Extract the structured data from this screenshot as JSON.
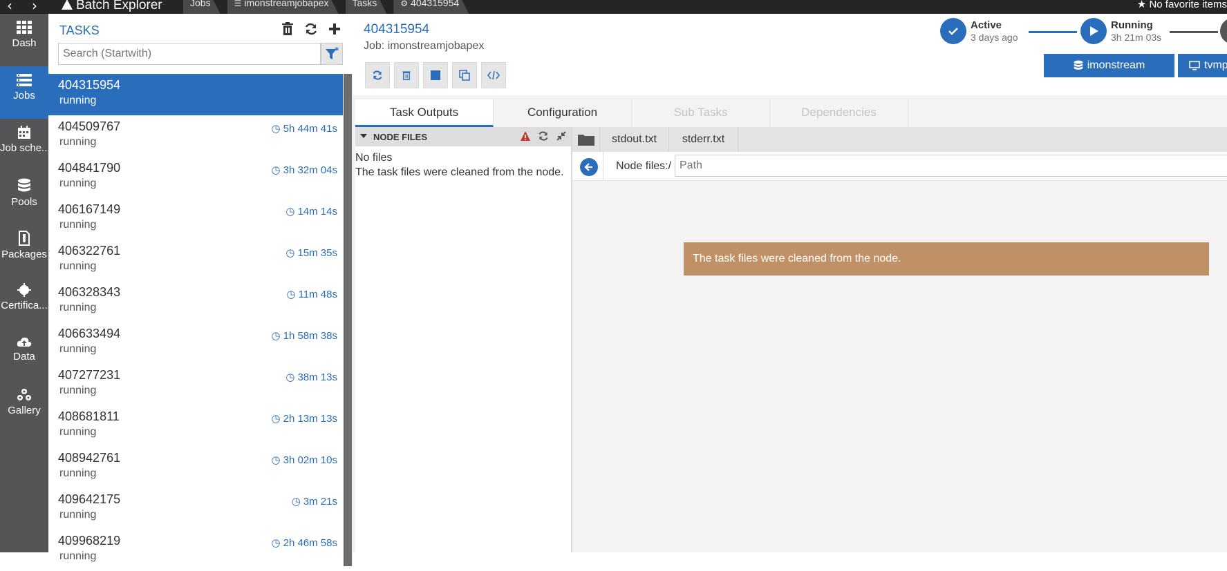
{
  "titlebar": {
    "app_title": "Batch Explorer",
    "breadcrumbs": [
      "Jobs",
      "imonstreamjobapex",
      "Tasks",
      "404315954"
    ],
    "favorites": "No favorite items"
  },
  "leftnav": {
    "items": [
      {
        "label": "Dash",
        "icon": "dashboard-icon"
      },
      {
        "label": "Jobs",
        "icon": "jobs-icon",
        "active": true
      },
      {
        "label": "Job sche...",
        "icon": "calendar-icon"
      },
      {
        "label": "Pools",
        "icon": "database-icon"
      },
      {
        "label": "Packages",
        "icon": "package-icon"
      },
      {
        "label": "Certifica...",
        "icon": "certificate-icon"
      },
      {
        "label": "Data",
        "icon": "cloud-upload-icon"
      },
      {
        "label": "Gallery",
        "icon": "gallery-icon"
      }
    ]
  },
  "tasklist": {
    "title": "TASKS",
    "search_placeholder": "Search (Startwith)",
    "tasks": [
      {
        "id": "404315954",
        "state": "running",
        "time": ""
      },
      {
        "id": "404509767",
        "state": "running",
        "time": "5h 44m 41s"
      },
      {
        "id": "404841790",
        "state": "running",
        "time": "3h 32m 04s"
      },
      {
        "id": "406167149",
        "state": "running",
        "time": "14m 14s"
      },
      {
        "id": "406322761",
        "state": "running",
        "time": "15m 35s"
      },
      {
        "id": "406328343",
        "state": "running",
        "time": "11m 48s"
      },
      {
        "id": "406633494",
        "state": "running",
        "time": "1h 58m 38s"
      },
      {
        "id": "407277231",
        "state": "running",
        "time": "38m 13s"
      },
      {
        "id": "408681811",
        "state": "running",
        "time": "2h 13m 13s"
      },
      {
        "id": "408942761",
        "state": "running",
        "time": "3h 02m 10s"
      },
      {
        "id": "409642175",
        "state": "running",
        "time": "3m 21s"
      },
      {
        "id": "409968219",
        "state": "running",
        "time": "2h 46m 58s"
      }
    ]
  },
  "detail": {
    "task_id": "404315954",
    "job_line": "Job: imonstreamjobapex",
    "timeline": {
      "active_label": "Active",
      "active_sub": "3 days ago",
      "running_label": "Running",
      "running_sub": "3h 21m 03s"
    },
    "pool_button": "imonstream",
    "node_button": "tvmp",
    "tabs": [
      {
        "label": "Task Outputs",
        "state": "active"
      },
      {
        "label": "Configuration",
        "state": "normal"
      },
      {
        "label": "Sub Tasks",
        "state": "disabled"
      },
      {
        "label": "Dependencies",
        "state": "disabled"
      }
    ]
  },
  "node_files": {
    "header": "NODE FILES",
    "empty_title": "No files",
    "empty_message": "The task files were cleaned from the node."
  },
  "file_view": {
    "tabs": [
      "stdout.txt",
      "stderr.txt"
    ],
    "path_label": "Node files:/",
    "path_placeholder": "Path",
    "banner": "The task files were cleaned from the node."
  },
  "colors": {
    "accent": "#2a6ebb",
    "nav_bg": "#555557",
    "titlebar_bg": "#252526",
    "warning_banner": "#c09166",
    "error_icon": "#c0392b"
  }
}
